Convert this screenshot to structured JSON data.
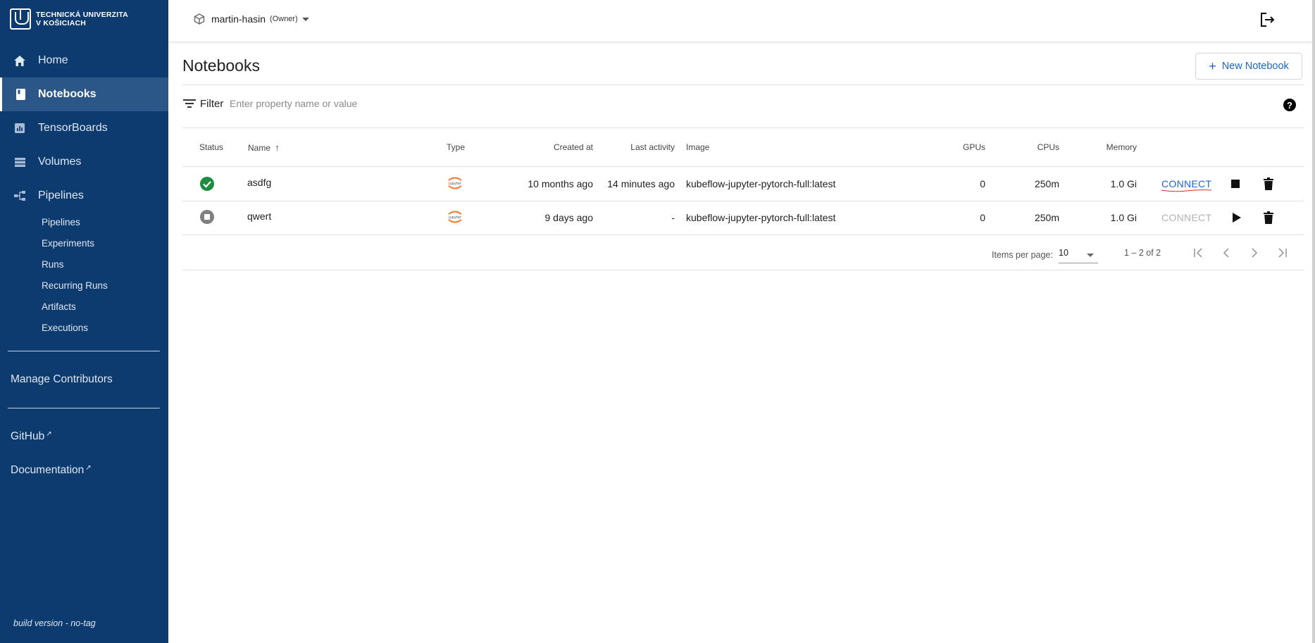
{
  "sidebar": {
    "logo_line1": "TECHNICKÁ UNIVERZITA",
    "logo_line2": "V KOŠICIACH",
    "nav": [
      {
        "label": "Home",
        "icon": "home-icon"
      },
      {
        "label": "Notebooks",
        "icon": "notebook-icon",
        "active": true
      },
      {
        "label": "TensorBoards",
        "icon": "chart-icon"
      },
      {
        "label": "Volumes",
        "icon": "storage-icon"
      },
      {
        "label": "Pipelines",
        "icon": "pipeline-icon"
      }
    ],
    "sub_items": [
      "Pipelines",
      "Experiments",
      "Runs",
      "Recurring Runs",
      "Artifacts",
      "Executions"
    ],
    "manage_contributors": "Manage Contributors",
    "github": "GitHub",
    "documentation": "Documentation",
    "build_version": "build version - no-tag"
  },
  "topbar": {
    "namespace": "martin-hasin",
    "role": "(Owner)"
  },
  "page": {
    "title": "Notebooks",
    "new_button": "New Notebook",
    "filter_label": "Filter",
    "filter_placeholder": "Enter property name or value"
  },
  "table": {
    "headers": {
      "status": "Status",
      "name": "Name",
      "type": "Type",
      "created": "Created at",
      "activity": "Last activity",
      "image": "Image",
      "gpus": "GPUs",
      "cpus": "CPUs",
      "memory": "Memory"
    },
    "rows": [
      {
        "status": "running",
        "name": "asdfg",
        "type_label": "jupyter",
        "created": "10 months ago",
        "activity": "14 minutes ago",
        "image": "kubeflow-jupyter-pytorch-full:latest",
        "gpus": "0",
        "cpus": "250m",
        "memory": "1.0 Gi",
        "connect": "CONNECT",
        "connect_enabled": true,
        "action": "stop-icon"
      },
      {
        "status": "stopped",
        "name": "qwert",
        "type_label": "jupyter",
        "created": "9 days ago",
        "activity": "-",
        "image": "kubeflow-jupyter-pytorch-full:latest",
        "gpus": "0",
        "cpus": "250m",
        "memory": "1.0 Gi",
        "connect": "CONNECT",
        "connect_enabled": false,
        "action": "play-icon"
      }
    ]
  },
  "pagination": {
    "items_per_page_label": "Items per page:",
    "items_per_page": "10",
    "range": "1 – 2 of 2"
  },
  "colors": {
    "sidebar": "#0d3b70",
    "accent": "#1a66c9",
    "success": "#1e8e3e",
    "stopped": "#808080",
    "jupyter": "#f37726"
  }
}
